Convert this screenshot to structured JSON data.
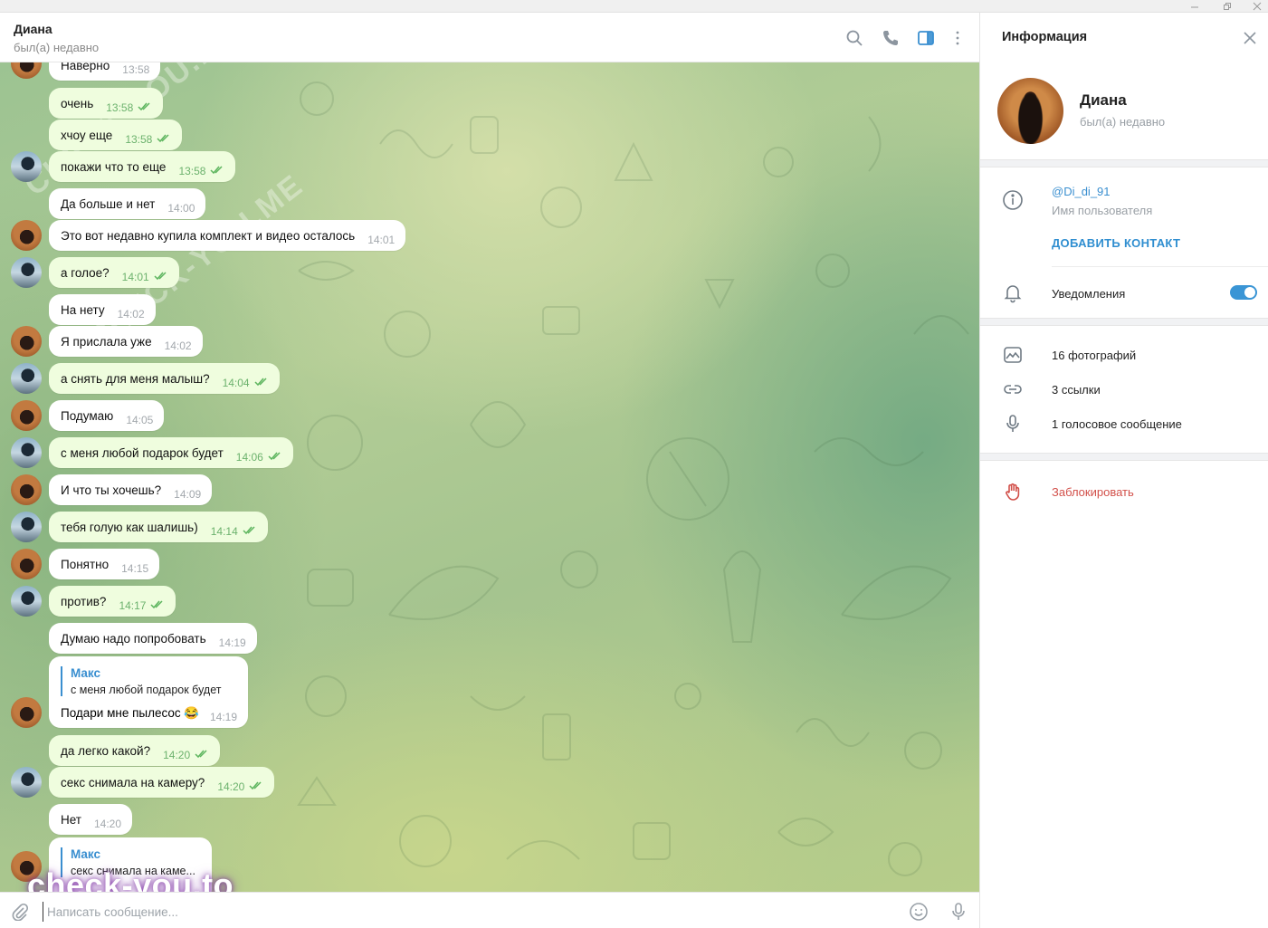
{
  "chat": {
    "name": "Диана",
    "status": "был(а) недавно"
  },
  "messages": [
    {
      "from": "Диана",
      "text": "Наверно",
      "time": "13:58"
    },
    {
      "from": "Макс",
      "text": "очень",
      "time": "13:58",
      "read": true
    },
    {
      "from": "Макс",
      "text": "хчоу еще",
      "time": "13:58",
      "read": true
    },
    {
      "from": "Макс",
      "text": "покажи что то еще",
      "time": "13:58",
      "read": true
    },
    {
      "from": "Диана",
      "text": "Да больше и нет",
      "time": "14:00"
    },
    {
      "from": "Диана",
      "text": "Это вот недавно купила комплект и видео осталось",
      "time": "14:01"
    },
    {
      "from": "Макс",
      "text": "а голое?",
      "time": "14:01",
      "read": true
    },
    {
      "from": "Диана",
      "text": "На нету",
      "time": "14:02"
    },
    {
      "from": "Диана",
      "text": "Я прислала уже",
      "time": "14:02"
    },
    {
      "from": "Макс",
      "text": "а снять для меня малыш?",
      "time": "14:04",
      "read": true
    },
    {
      "from": "Диана",
      "text": "Подумаю",
      "time": "14:05"
    },
    {
      "from": "Макс",
      "text": "с меня любой подарок будет",
      "time": "14:06",
      "read": true
    },
    {
      "from": "Диана",
      "text": "И что ты хочешь?",
      "time": "14:09"
    },
    {
      "from": "Макс",
      "text": "тебя голую как шалишь)",
      "time": "14:14",
      "read": true
    },
    {
      "from": "Диана",
      "text": "Понятно",
      "time": "14:15"
    },
    {
      "from": "Макс",
      "text": "против?",
      "time": "14:17",
      "read": true
    },
    {
      "from": "Диана",
      "text": "Думаю надо попробовать",
      "time": "14:19"
    },
    {
      "from": "Диана",
      "reply_author": "Макс",
      "reply_text": "с меня любой подарок будет",
      "text": "Подари мне пылесос 😂",
      "time": "14:19"
    },
    {
      "from": "Макс",
      "text": "да легко какой?",
      "time": "14:20",
      "read": true
    },
    {
      "from": "Макс",
      "text": "секс снимала на камеру?",
      "time": "14:20",
      "read": true
    },
    {
      "from": "Диана",
      "text": "Нет",
      "time": "14:20"
    },
    {
      "from": "Диана",
      "reply_author": "Макс",
      "reply_text": "секс снимала на каме..."
    }
  ],
  "composer": {
    "placeholder": "Написать сообщение..."
  },
  "info_panel": {
    "title": "Информация",
    "name": "Диана",
    "status": "был(а) недавно",
    "username": "@Di_di_91",
    "username_label": "Имя пользователя",
    "add_contact": "ДОБАВИТЬ КОНТАКТ",
    "notifications_label": "Уведомления",
    "notifications_on": true,
    "media": [
      {
        "icon": "photo-icon",
        "label": "16 фотографий"
      },
      {
        "icon": "link-icon",
        "label": "3 ссылки"
      },
      {
        "icon": "microphone-icon",
        "label": "1 голосовое сообщение"
      }
    ],
    "block_label": "Заблокировать"
  },
  "watermarks": {
    "bottom": "check-you.to",
    "diagonal_1": "CHECK-YOU.ME",
    "diagonal_2": "CHECK-YOU.ME"
  },
  "colors": {
    "outgoing_bubble": "#effdde",
    "incoming_bubble": "#ffffff",
    "accent": "#3a8fd0",
    "read_check": "#5db55e",
    "danger": "#d2504a"
  }
}
